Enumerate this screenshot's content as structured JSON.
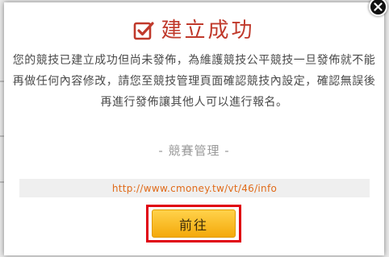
{
  "dialog": {
    "title": "建立成功",
    "message": "您的競技已建立成功但尚未發佈，為維護競技公平競技一旦發佈就不能再做任何內容修改，請您至競技管理頁面確認競技內設定，確認無誤後再進行發佈讓其他人可以進行報名。",
    "manage_label": "- 競賽管理 -",
    "url": "http://www.cmoney.tw/vt/46/info",
    "go_button": "前往"
  },
  "colors": {
    "title": "#c0392b",
    "link": "#e06b1a",
    "button": "#f4a90b",
    "highlight_border": "#e00010"
  },
  "icons": {
    "title_icon": "check-square-icon",
    "close": "close-icon"
  }
}
